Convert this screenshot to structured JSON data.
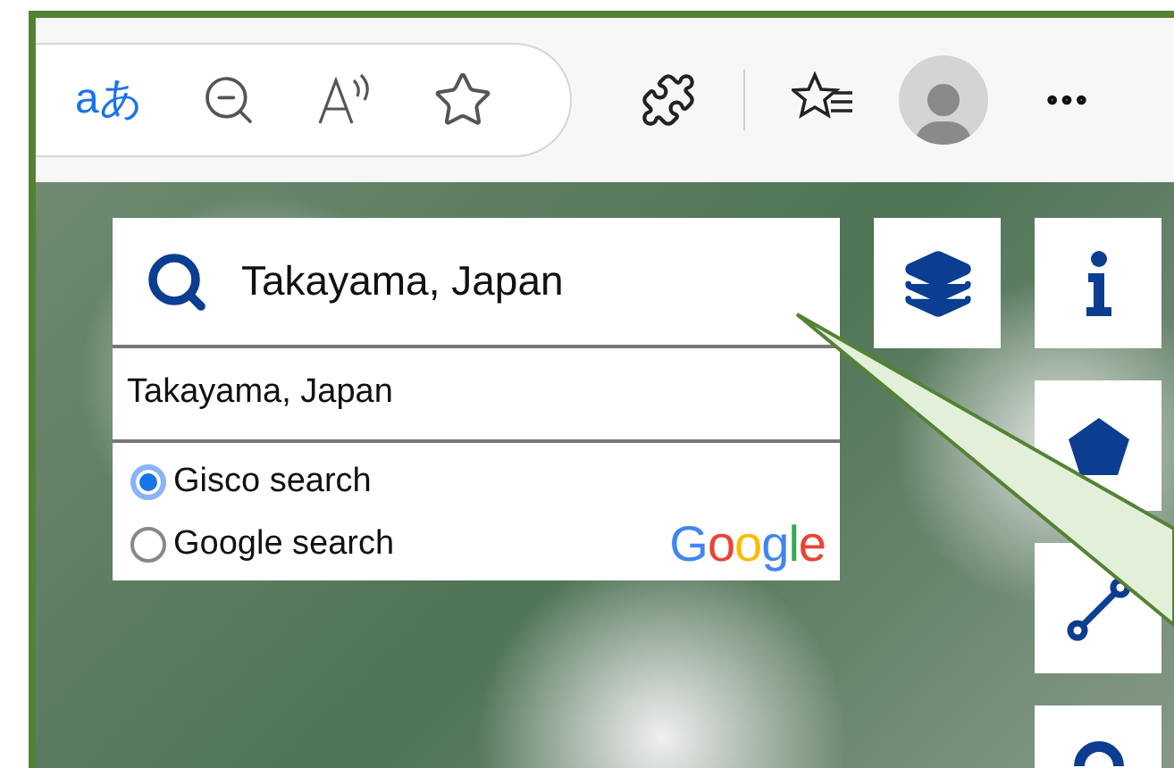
{
  "browser_toolbar": {
    "translate_label": "aあ"
  },
  "search": {
    "value": "Takayama, Japan"
  },
  "suggestions": [
    {
      "text": "Takayama, Japan"
    }
  ],
  "search_options": [
    {
      "label": "Gisco search",
      "selected": true
    },
    {
      "label": "Google search",
      "selected": false
    }
  ],
  "provider_logo": "Google"
}
